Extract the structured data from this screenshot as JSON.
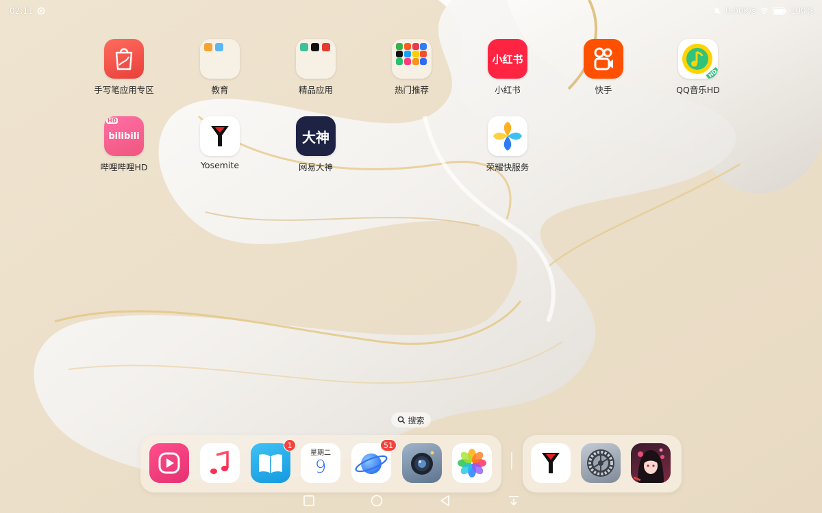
{
  "status_bar": {
    "time": "02:11",
    "speed": "0.00K/s",
    "battery": "100%"
  },
  "home_apps": [
    {
      "label": "手写笔应用专区",
      "icon": "stylus-zone-icon"
    },
    {
      "label": "教育",
      "icon": "folder-icon"
    },
    {
      "label": "精品应用",
      "icon": "folder-icon"
    },
    {
      "label": "热门推荐",
      "icon": "folder-icon"
    },
    {
      "label": "小红书",
      "icon_text": "小红书",
      "icon": "xiaohongshu-icon"
    },
    {
      "label": "快手",
      "icon": "kuaishou-icon"
    },
    {
      "label": "QQ音乐HD",
      "icon_badge": "HD",
      "icon": "qq-music-icon"
    },
    {
      "label": "哔哩哔哩HD",
      "icon_text": "bilibili",
      "icon_badge": "HD",
      "icon": "bilibili-icon"
    },
    {
      "label": "Yosemite",
      "icon": "yosemite-icon"
    },
    {
      "label": "网易大神",
      "icon_text": "大神",
      "icon": "netease-dashen-icon"
    },
    {
      "label": "荣耀快服务",
      "icon": "honor-quick-service-icon"
    }
  ],
  "search": {
    "label": "搜索"
  },
  "dock": {
    "apps": [
      {
        "name": "video-app",
        "icon": "play-icon"
      },
      {
        "name": "music-app",
        "icon": "music-note-icon"
      },
      {
        "name": "books-app",
        "icon": "book-icon",
        "badge": "1"
      },
      {
        "name": "calendar-app",
        "icon": "calendar-icon",
        "weekday": "星期二",
        "day": "9"
      },
      {
        "name": "browser-app",
        "icon": "planet-icon",
        "badge": "51"
      },
      {
        "name": "camera-app",
        "icon": "camera-icon"
      },
      {
        "name": "gallery-app",
        "icon": "gallery-flower-icon"
      }
    ],
    "recent_apps": [
      {
        "name": "yosemite-app",
        "icon": "yosemite-icon"
      },
      {
        "name": "settings-app",
        "icon": "gear-icon"
      },
      {
        "name": "game-app",
        "icon": "anime-game-icon"
      }
    ]
  },
  "colors": {
    "badge": "#f2453d",
    "label_text": "#2b2b2b"
  }
}
